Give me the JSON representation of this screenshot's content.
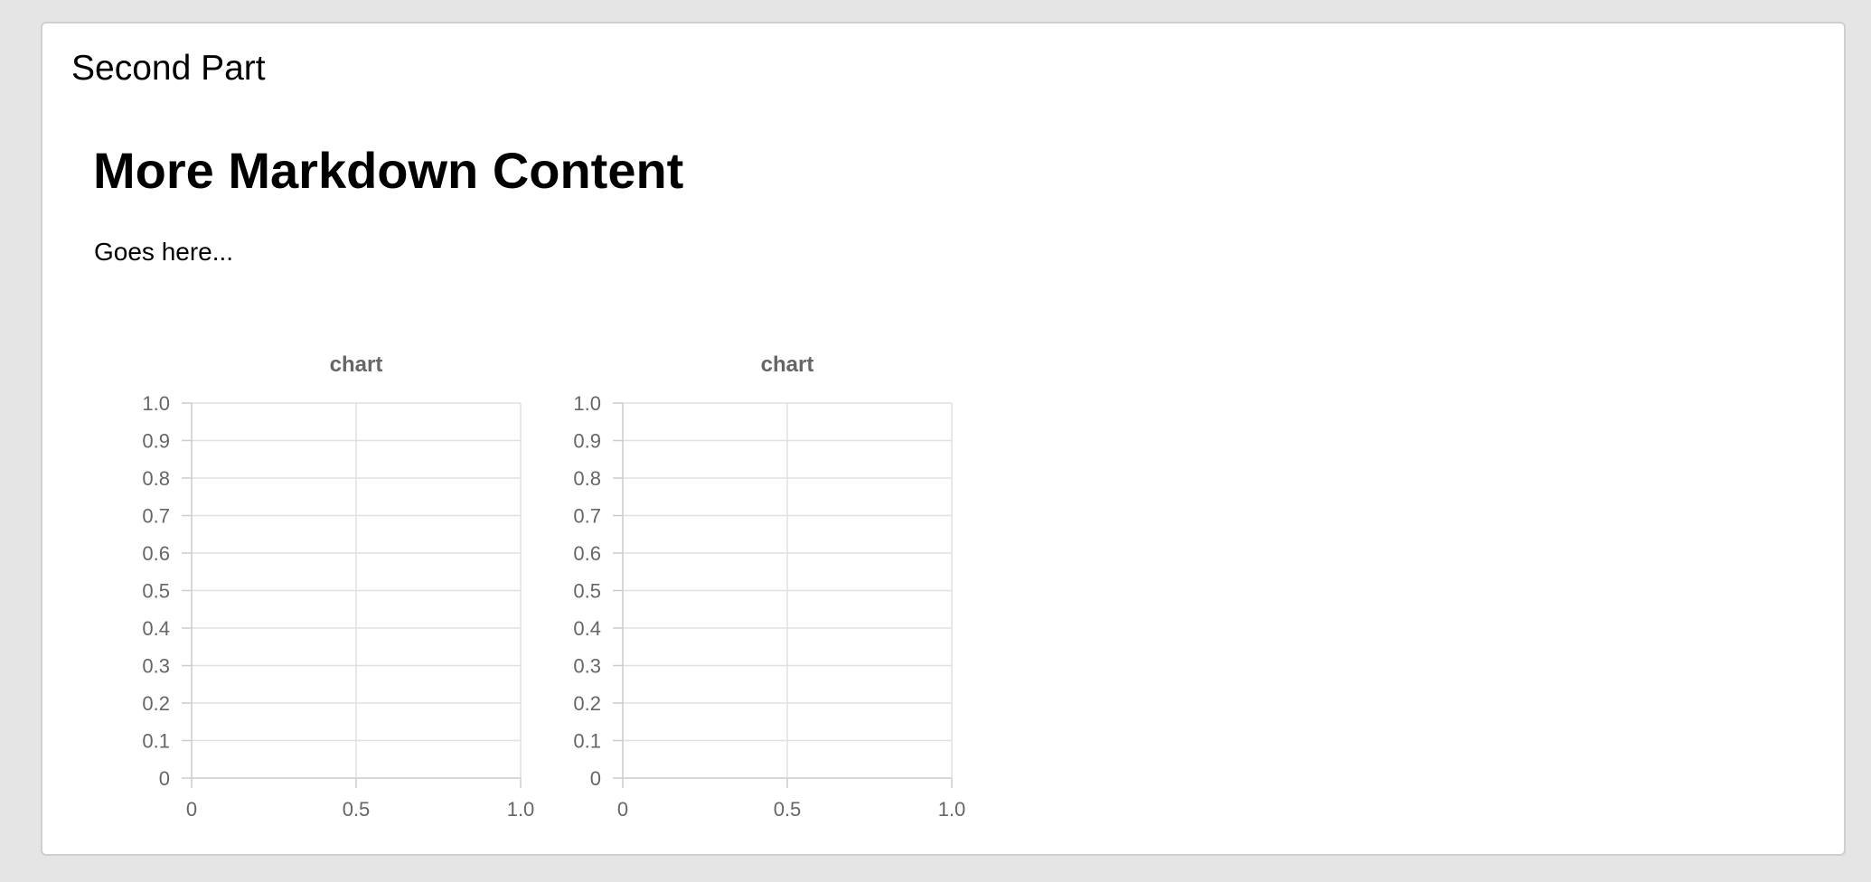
{
  "card": {
    "title": "Second Part"
  },
  "markdown": {
    "heading": "More Markdown Content",
    "paragraph": "Goes here..."
  },
  "colors": {
    "page_background": "#e5e5e5",
    "card_background": "#ffffff",
    "card_border": "#cfcfcf",
    "grid_line": "#e0e0e0",
    "axis_line": "#cccccc",
    "chart_text": "#666666"
  },
  "chart_data": [
    {
      "type": "line",
      "title": "chart",
      "xlabel": "",
      "ylabel": "",
      "xlim": [
        0,
        1.0
      ],
      "ylim": [
        0,
        1.0
      ],
      "x_ticks": [
        "0",
        "0.5",
        "1.0"
      ],
      "y_ticks": [
        "0",
        "0.1",
        "0.2",
        "0.3",
        "0.4",
        "0.5",
        "0.6",
        "0.7",
        "0.8",
        "0.9",
        "1.0"
      ],
      "grid": true,
      "series": []
    },
    {
      "type": "line",
      "title": "chart",
      "xlabel": "",
      "ylabel": "",
      "xlim": [
        0,
        1.0
      ],
      "ylim": [
        0,
        1.0
      ],
      "x_ticks": [
        "0",
        "0.5",
        "1.0"
      ],
      "y_ticks": [
        "0",
        "0.1",
        "0.2",
        "0.3",
        "0.4",
        "0.5",
        "0.6",
        "0.7",
        "0.8",
        "0.9",
        "1.0"
      ],
      "grid": true,
      "series": []
    }
  ]
}
